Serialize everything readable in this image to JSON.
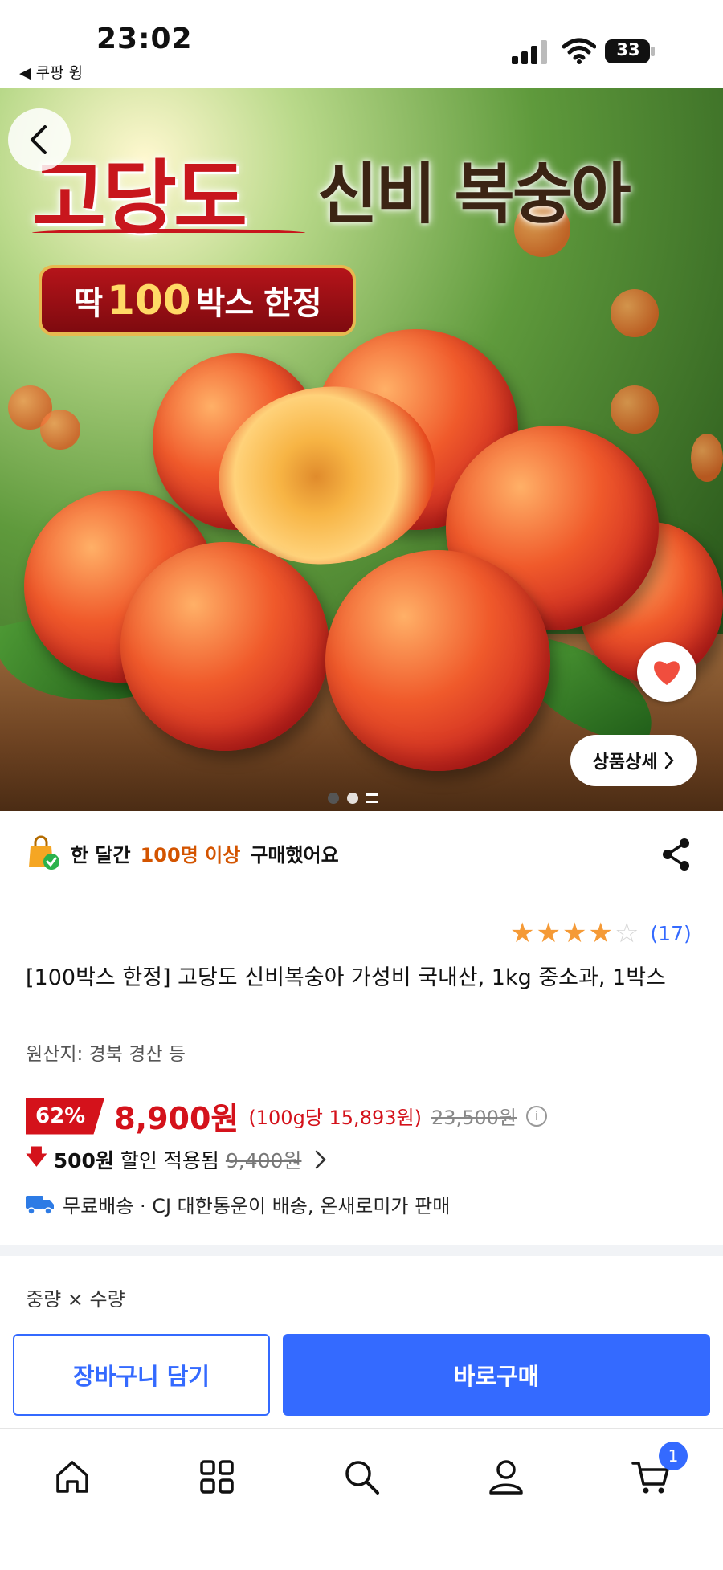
{
  "status_bar": {
    "time": "23:02",
    "back_app_label": "◀ 쿠팡 윙",
    "battery": "33"
  },
  "hero": {
    "title_main": "고당도",
    "title_sub": "신비 복숭아",
    "badge_pre": "딱",
    "badge_num": "100",
    "badge_post": "박스 한정",
    "detail_button": "상품상세",
    "page_dots": 3,
    "active_dot": 0
  },
  "purchase_info": {
    "prefix": "한 달간",
    "highlight": "100명 이상",
    "suffix": "구매했어요"
  },
  "rating": {
    "stars": 4,
    "max_stars": 5,
    "count": "(17)"
  },
  "product": {
    "title": "[100박스 한정] 고당도 신비복숭아 가성비 국내산, 1kg 중소과, 1박스",
    "origin": "원산지: 경북 경산 등"
  },
  "price": {
    "discount_rate": "62%",
    "sale_price": "8,900원",
    "unit_price": "(100g당 15,893원)",
    "original_price": "23,500원",
    "info_icon": "i"
  },
  "coupon": {
    "amount": "500원",
    "label": "할인 적용됨",
    "before_price": "9,400원"
  },
  "shipping": {
    "text": "무료배송 · CJ 대한통운이 배송, 온새로미가 판매"
  },
  "options": {
    "label": "중량 × 수량"
  },
  "cta": {
    "cart_label": "장바구니 담기",
    "buy_label": "바로구매"
  },
  "tabbar": {
    "cart_badge": "1",
    "icons": [
      "home-icon",
      "category-grid-icon",
      "search-icon",
      "my-account-icon",
      "cart-icon"
    ]
  },
  "colors": {
    "accent_blue": "#346aff",
    "discount_red": "#d4121b",
    "highlight_orange": "#d35400",
    "star_orange": "#f59a36"
  }
}
